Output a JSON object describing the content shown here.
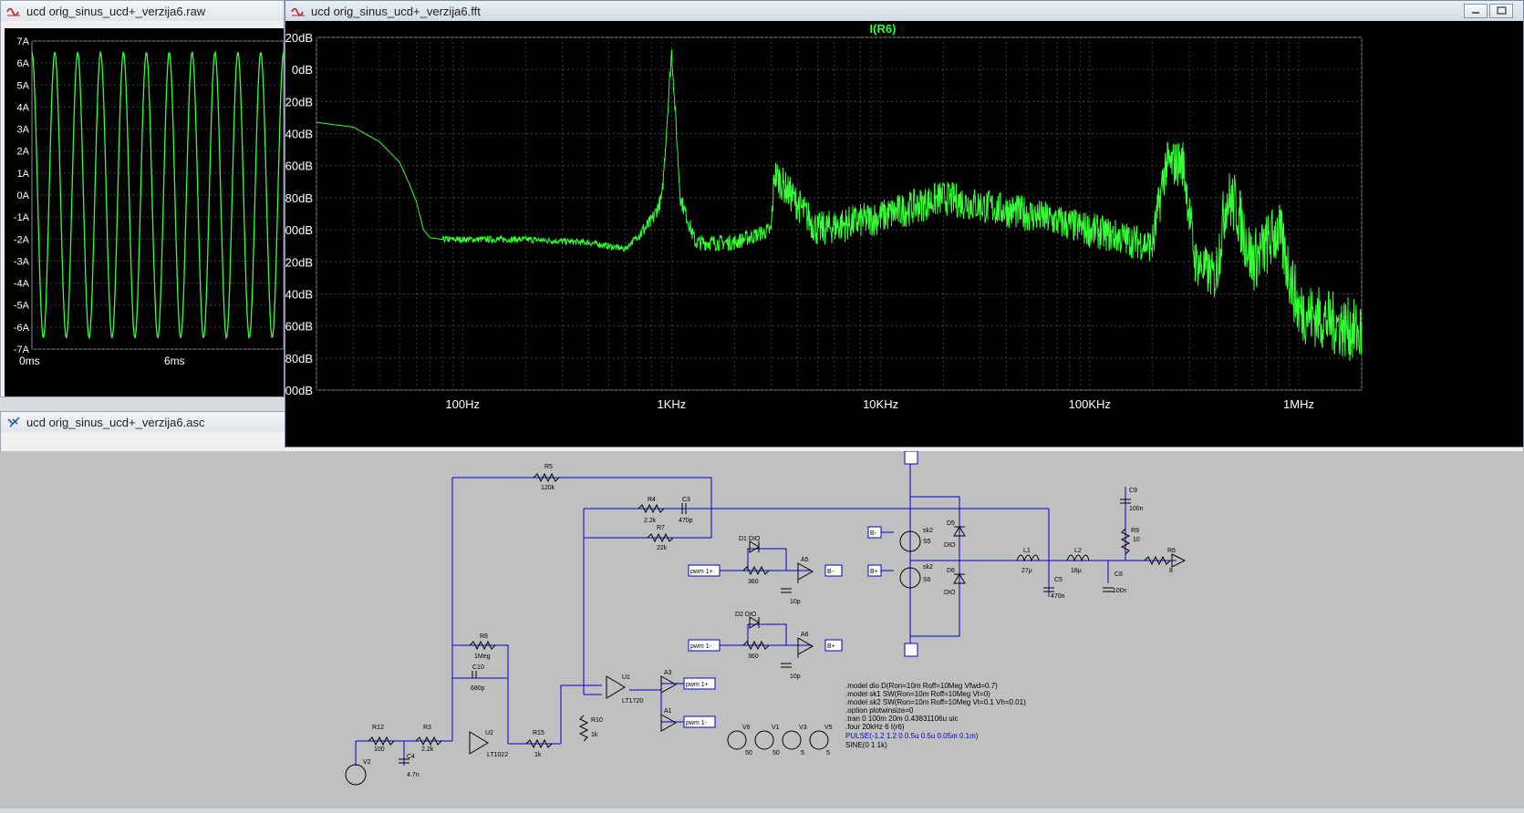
{
  "raw_window": {
    "title": "ucd orig_sinus_ucd+_verzija6.raw",
    "yticks": [
      "7A",
      "6A",
      "5A",
      "4A",
      "3A",
      "2A",
      "1A",
      "0A",
      "-1A",
      "-2A",
      "-3A",
      "-4A",
      "-5A",
      "-6A",
      "-7A"
    ],
    "xticks": [
      "0ms",
      "6ms"
    ]
  },
  "fft_window": {
    "title": "ucd orig_sinus_ucd+_verzija6.fft",
    "trace_label": "I(R6)",
    "yticks": [
      "20dB",
      "0dB",
      "-20dB",
      "-40dB",
      "-60dB",
      "-80dB",
      "-100dB",
      "-120dB",
      "-140dB",
      "-160dB",
      "-180dB",
      "-200dB"
    ],
    "xticks": [
      "100Hz",
      "1KHz",
      "10KHz",
      "100KHz",
      "1MHz"
    ]
  },
  "asc_window": {
    "title": "ucd orig_sinus_ucd+_verzija6.asc"
  },
  "chart_data": [
    {
      "type": "line",
      "series": [
        {
          "values_description": "sine",
          "amplitude": 6.5,
          "cycles": 11
        }
      ],
      "ylim": [
        -7,
        7
      ],
      "trace_color": "#33ff33"
    },
    {
      "type": "line",
      "title": "I(R6)",
      "xscale": "log",
      "xlim": [
        20,
        2000000
      ],
      "ylim": [
        -200,
        20
      ],
      "trace_color": "#33ff33",
      "series": [
        {
          "name": "I(R6)",
          "x": [
            20,
            30,
            40,
            50,
            55,
            60,
            65,
            70,
            80,
            100,
            200,
            400,
            600,
            800,
            900,
            1000,
            1100,
            1300,
            2000,
            3000,
            3100,
            5000,
            10000,
            20000,
            30000,
            50000,
            100000,
            200000,
            230000,
            280000,
            320000,
            400000,
            450000,
            500000,
            600000,
            700000,
            800000,
            1000000,
            2000000
          ],
          "y": [
            -33,
            -36,
            -45,
            -58,
            -70,
            -82,
            -100,
            -105,
            -106,
            -106,
            -106,
            -108,
            -112,
            -95,
            -80,
            12,
            -80,
            -108,
            -108,
            -100,
            -65,
            -100,
            -92,
            -80,
            -85,
            -90,
            -100,
            -110,
            -60,
            -58,
            -120,
            -130,
            -80,
            -85,
            -120,
            -110,
            -100,
            -150,
            -165
          ]
        }
      ]
    }
  ],
  "schematic": {
    "components": [
      "R5",
      "120k",
      "R4",
      "2.2k",
      "C3",
      "470p",
      "R7",
      "22k",
      "D1",
      "DIO",
      "A5",
      "pwm 1+",
      "B-",
      "360",
      "10p",
      "D2",
      "DIO",
      "A6",
      "pwm 1-",
      "B+",
      "360",
      "10p",
      "R8",
      "1Meg",
      "C10",
      "680p",
      "U2",
      "LT1022",
      "R12",
      "100",
      "R3",
      "2.2k",
      "C4",
      "4.7n",
      "V2",
      "R15",
      "1k",
      "R10",
      "1k",
      "U1",
      "LT1720",
      "A3",
      "pwm 1+",
      "A1",
      "pwm 1-",
      "B+",
      "sk2",
      "S5",
      "B-",
      "sk2",
      "S6",
      "D5",
      "DIO",
      "D6",
      "DIO",
      "L1",
      "27µ",
      "C5",
      "470n",
      "L2",
      "18µ",
      "C8",
      "100n",
      "C9",
      "100n",
      "R9",
      "10",
      "R6",
      "8",
      "V6",
      "V1",
      "V3",
      "V5",
      "50",
      "50",
      "5",
      "5"
    ],
    "directives": [
      ".model dio D(Ron=10m Roff=10Meg Vfwd=0.7)",
      ".model sk1 SW(Ron=10m Roff=10Meg Vt=0)",
      ".model sk2 SW(Ron=10m Roff=10Meg Vt=0.1 Vh=0.01)",
      ".option plotwinsize=0",
      ".tran 0 100m 20m 0.43831106u uic",
      ".four 20kHz 6 I(r6)",
      "PULSE(-1.2 1.2 0 0.5u 0.5u 0.05m 0.1m)",
      "SINE(0 1 1k)"
    ]
  }
}
